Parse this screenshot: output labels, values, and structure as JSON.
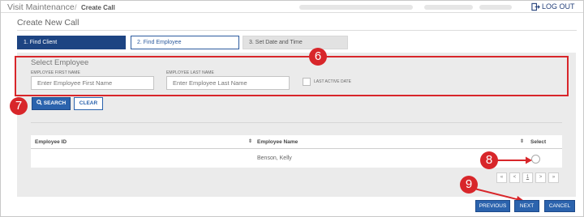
{
  "breadcrumb": {
    "main": "Visit Maintenance",
    "separator": "/",
    "current": "Create Call"
  },
  "header": {
    "logout_label": "LOG OUT",
    "logout_icon": "logout-icon"
  },
  "page": {
    "title": "Create New Call"
  },
  "steps": [
    {
      "label": "1. Find Client",
      "state": "active"
    },
    {
      "label": "2. Find Employee",
      "state": "current"
    },
    {
      "label": "3. Set Date and Time",
      "state": "disabled"
    }
  ],
  "select_employee": {
    "title": "Select Employee",
    "first_name_label": "EMPLOYEE FIRST NAME",
    "first_name_placeholder": "Enter Employee First Name",
    "first_name_value": "",
    "last_name_label": "EMPLOYEE LAST NAME",
    "last_name_placeholder": "Enter Employee Last Name",
    "last_name_value": "",
    "last_active_label": "LAST ACTIVE DATE",
    "last_active_checked": false
  },
  "actions": {
    "search_label": "SEARCH",
    "search_icon": "search-icon",
    "clear_label": "CLEAR"
  },
  "table": {
    "columns": [
      "Employee ID",
      "Employee Name",
      "Select"
    ],
    "rows": [
      {
        "employee_id": "",
        "employee_name": "Benson, Kelly",
        "selected": false
      }
    ]
  },
  "pager": {
    "first": "«",
    "prev": "<",
    "page": "1",
    "next": ">",
    "last": "»"
  },
  "buttons": {
    "previous": "PREVIOUS",
    "next": "NEXT",
    "cancel": "CANCEL"
  },
  "callouts": [
    "6",
    "7",
    "8",
    "9"
  ],
  "colors": {
    "primary_dark": "#1d4482",
    "primary": "#2b63ad",
    "callout_red": "#d8262a",
    "panel_gray": "#ebebeb"
  }
}
